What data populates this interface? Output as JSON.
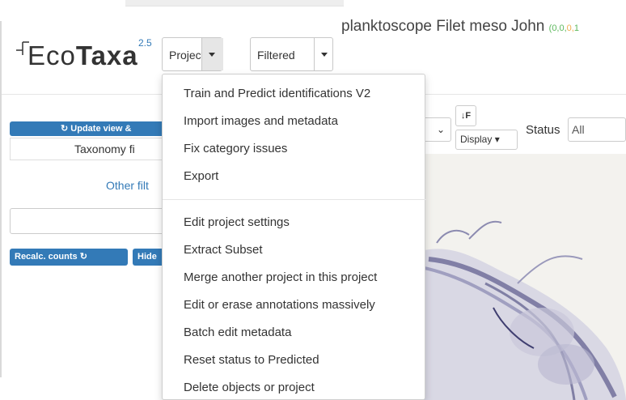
{
  "logo": {
    "text_eco": "Eco",
    "text_taxa": "Taxa",
    "version": "2.5"
  },
  "toolbar": {
    "project_label": "Project",
    "filtered_label": "Filtered"
  },
  "project": {
    "title": "planktoscope Filet meso John",
    "counts_a": "(0,0,",
    "counts_b": "0,",
    "counts_c": "1"
  },
  "left_panel": {
    "update_view_label": "Update view &",
    "taxonomy_filter_label": "Taxonomy fi",
    "other_filters_label": "Other filt",
    "recalc_counts_label": "Recalc. counts",
    "hide_label": "Hide"
  },
  "view_controls": {
    "select_chevron": "⌄",
    "display_label": "Display",
    "status_label": "Status",
    "status_value": "All"
  },
  "project_menu": {
    "items_group1": [
      "Train and Predict identifications V2",
      "Import images and metadata",
      "Fix category issues",
      "Export"
    ],
    "items_group2": [
      "Edit project settings",
      "Extract Subset",
      "Merge another project in this project",
      "Edit or erase annotations massively",
      "Batch edit metadata",
      "Reset status to Predicted",
      "Delete objects or project"
    ]
  },
  "colors": {
    "accent": "#337ab7",
    "count_green": "#5cb85c",
    "count_orange": "#f0ad4e"
  },
  "icons": [
    "refresh-icon",
    "caret-down-icon",
    "sort-icon",
    "chevron-down-icon"
  ]
}
